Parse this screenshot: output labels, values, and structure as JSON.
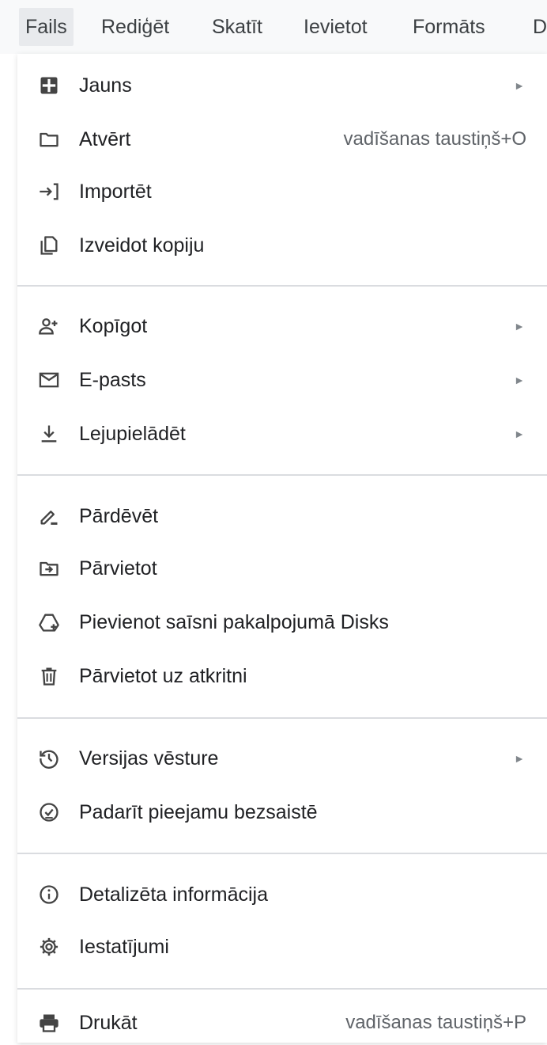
{
  "menubar": {
    "items": [
      "Fails",
      "Rediģēt",
      "Skatīt",
      "Ievietot",
      "Formāts",
      "D"
    ]
  },
  "menu": {
    "submenu_arrow": "►",
    "items": [
      {
        "label": "Jauns",
        "icon": "new-document-icon",
        "submenu": true
      },
      {
        "label": "Atvērt",
        "icon": "folder-icon",
        "shortcut": "vadīšanas taustiņš+O"
      },
      {
        "label": "Importēt",
        "icon": "import-icon"
      },
      {
        "label": "Izveidot kopiju",
        "icon": "copy-icon"
      },
      {
        "label": "Kopīgot",
        "icon": "share-person-add-icon",
        "submenu": true
      },
      {
        "label": "E-pasts",
        "icon": "mail-icon",
        "submenu": true
      },
      {
        "label": "Lejupielādēt",
        "icon": "download-icon",
        "submenu": true
      },
      {
        "label": "Pārdēvēt",
        "icon": "rename-pencil-icon"
      },
      {
        "label": "Pārvietot",
        "icon": "move-folder-icon"
      },
      {
        "label": "Pievienot saīsni pakalpojumā Disks",
        "icon": "drive-shortcut-icon"
      },
      {
        "label": "Pārvietot uz atkritni",
        "icon": "trash-icon"
      },
      {
        "label": "Versijas vēsture",
        "icon": "history-icon",
        "submenu": true
      },
      {
        "label": "Padarīt pieejamu bezsaistē",
        "icon": "offline-check-icon"
      },
      {
        "label": "Detalizēta informācija",
        "icon": "info-icon"
      },
      {
        "label": "Iestatījumi",
        "icon": "gear-icon"
      },
      {
        "label": "Drukāt",
        "icon": "printer-icon",
        "shortcut": "vadīšanas taustiņš+P"
      }
    ]
  }
}
